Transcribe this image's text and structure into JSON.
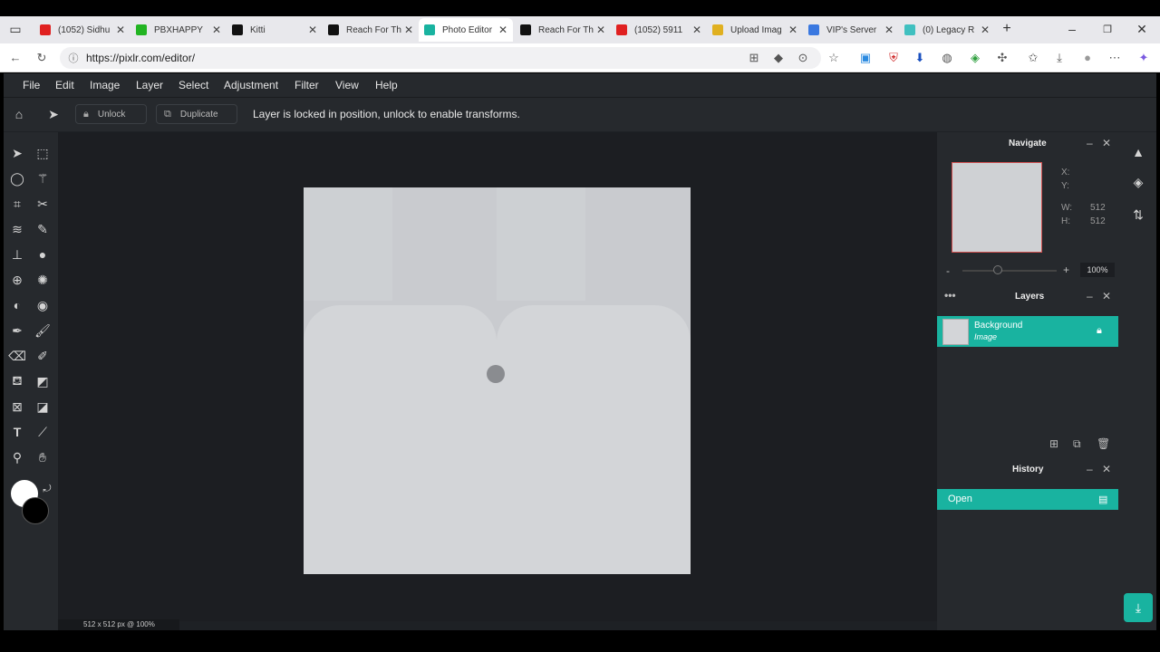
{
  "browser": {
    "tabs": [
      {
        "title": "(1052) Sidhu",
        "color": "#e02020"
      },
      {
        "title": "PBXHAPPY",
        "color": "#22b422"
      },
      {
        "title": "Kitti",
        "color": "#111111"
      },
      {
        "title": "Reach For Th",
        "color": "#111111"
      },
      {
        "title": "Photo Editor",
        "color": "#19b3a0",
        "active": true
      },
      {
        "title": "Reach For Th",
        "color": "#111111"
      },
      {
        "title": "(1052) 5911",
        "color": "#e02020"
      },
      {
        "title": "Upload Imag",
        "color": "#e0b020"
      },
      {
        "title": "VIP's Server",
        "color": "#3a78e0"
      },
      {
        "title": "(0) Legacy R",
        "color": "#40c0c0"
      }
    ],
    "url": "https://pixlr.com/editor/"
  },
  "menu": {
    "file": "File",
    "edit": "Edit",
    "image": "Image",
    "layer": "Layer",
    "select": "Select",
    "adjustment": "Adjustment",
    "filter": "Filter",
    "view": "View",
    "help": "Help"
  },
  "options": {
    "unlock": "Unlock",
    "duplicate": "Duplicate",
    "message": "Layer is locked in position, unlock to enable transforms."
  },
  "navigate": {
    "title": "Navigate",
    "x_label": "X:",
    "y_label": "Y:",
    "w_label": "W:",
    "w_value": "512",
    "h_label": "H:",
    "h_value": "512",
    "zoom": "100%",
    "minus": "-",
    "plus": "+"
  },
  "layers": {
    "title": "Layers",
    "items": [
      {
        "name": "Background",
        "type": "Image"
      }
    ]
  },
  "history": {
    "title": "History",
    "items": [
      "Open"
    ]
  },
  "status": "512 x 512 px @ 100%",
  "colors": {
    "accent": "#19b3a0",
    "panel": "#26292d",
    "app_bg": "#1e2125"
  }
}
